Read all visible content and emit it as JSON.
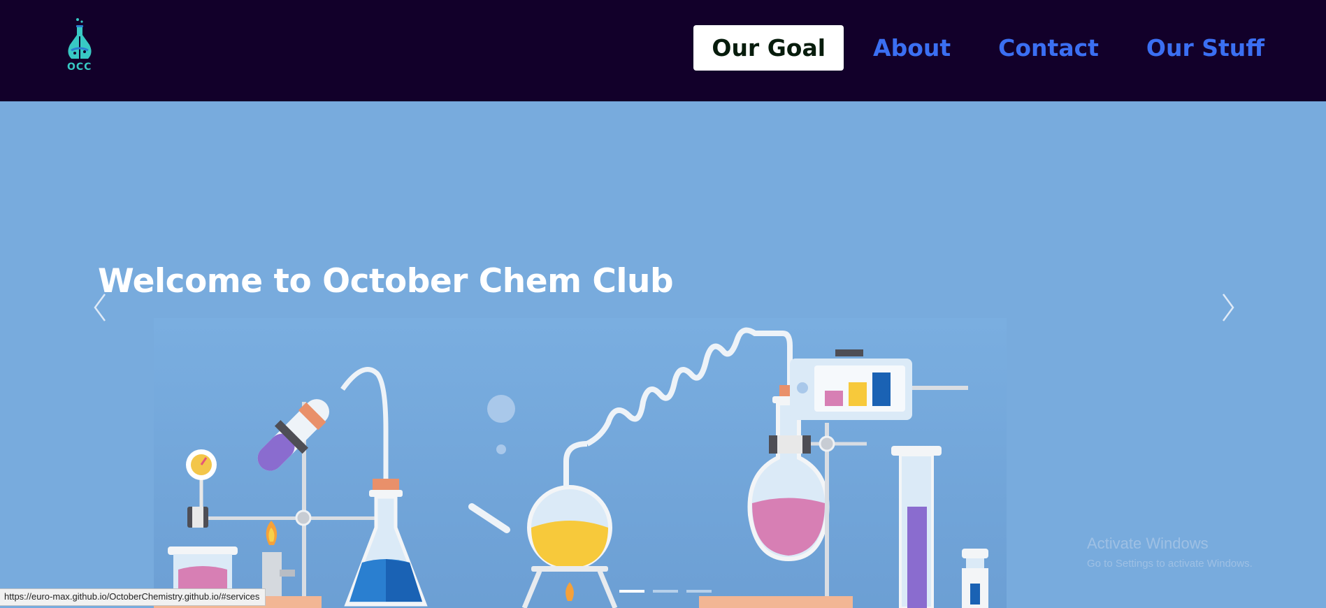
{
  "logo": {
    "text": "OCC",
    "icon": "flask-logo-icon"
  },
  "nav": {
    "links": [
      {
        "label": "Our Goal",
        "active": true
      },
      {
        "label": "About",
        "active": false
      },
      {
        "label": "Contact",
        "active": false
      },
      {
        "label": "Our Stuff",
        "active": false
      }
    ]
  },
  "hero": {
    "title": "Welcome to October Chem Club",
    "prev_icon": "chevron-left-icon",
    "next_icon": "chevron-right-icon",
    "illustration": "chemistry-lab-illustration",
    "slide_count": 3,
    "active_slide": 1
  },
  "watermark": {
    "title": "Activate Windows",
    "subtitle": "Go to Settings to activate Windows."
  },
  "status_bar": {
    "url": "https://euro-max.github.io/OctoberChemistry.github.io/#services"
  },
  "colors": {
    "navbar_bg": "#12002a",
    "nav_link": "#3b6ff2",
    "hero_bg": "#78abdd",
    "logo_accent": "#38c9c4"
  }
}
